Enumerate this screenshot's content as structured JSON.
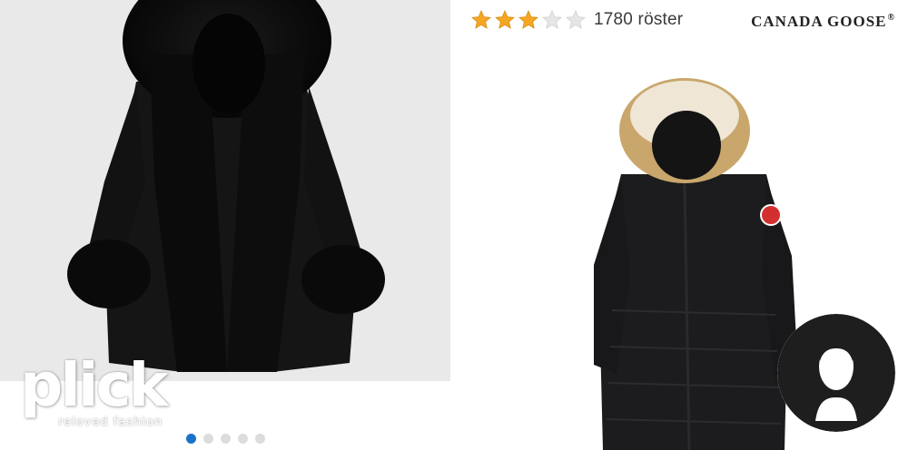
{
  "listing": {
    "brand_logo": {
      "main": "plick",
      "tagline": "reloved fashion"
    },
    "carousel": {
      "total": 5,
      "active_index": 0
    }
  },
  "review": {
    "rating": {
      "stars_filled": 3,
      "stars_total": 5,
      "count_label": "1780 röster"
    },
    "brand_label": "CANADA GOOSE",
    "brand_reg_mark": "®"
  },
  "colors": {
    "star_filled": "#f5a623",
    "star_empty": "#e6e6e6",
    "dot_active": "#1a73c9",
    "dot_inactive": "#dcdcdc",
    "coat": "#1c1c1e",
    "photo_bg": "#e9e9e9"
  },
  "icons": {
    "star": "star-icon",
    "avatar": "user-silhouette-icon",
    "patch": "canada-goose-patch-icon"
  }
}
